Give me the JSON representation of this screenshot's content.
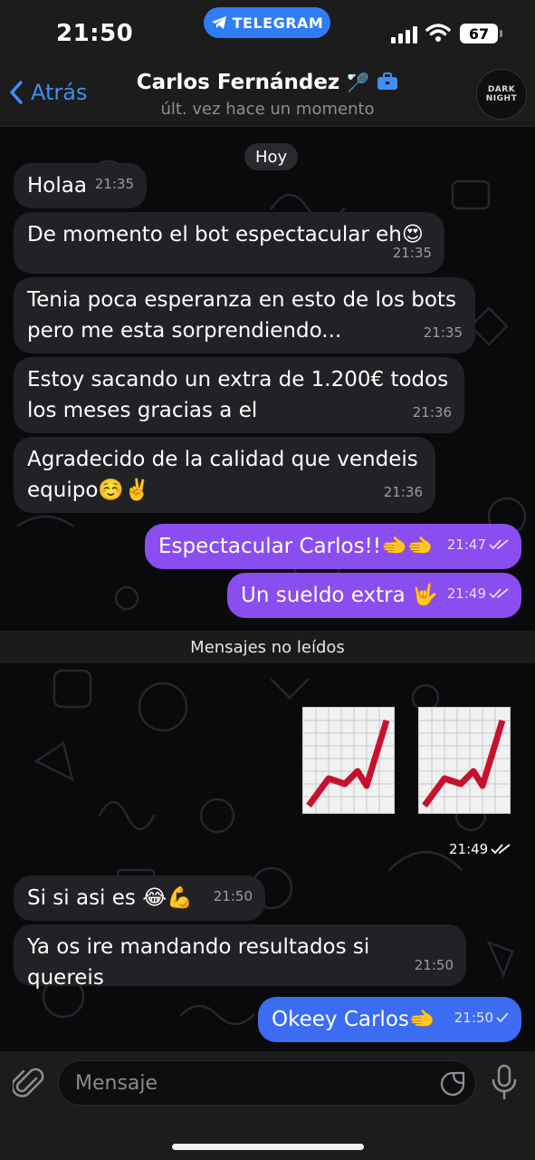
{
  "status_bar": {
    "time": "21:50",
    "pill_label": "TELEGRAM",
    "battery": "67"
  },
  "header": {
    "back_label": "Atrás",
    "name": "Carlos Fernández",
    "status": "últ. vez hace un momento",
    "avatar_text": [
      "DARK",
      "NIGHT"
    ]
  },
  "chat": {
    "date_chip": "Hoy",
    "unread_label": "Mensajes no leídos",
    "messages": [
      {
        "dir": "in",
        "text": "Holaa",
        "time": "21:35"
      },
      {
        "dir": "in",
        "text": "De momento el bot espectacular eh😍",
        "time": "21:35"
      },
      {
        "dir": "in",
        "text_lines": [
          "Tenia poca esperanza en esto de los bots",
          "pero me esta sorprendiendo..."
        ],
        "time": "21:35"
      },
      {
        "dir": "in",
        "text_lines": [
          "Estoy sacando un extra de 1.200€ todos",
          "los meses gracias a el"
        ],
        "time": "21:36"
      },
      {
        "dir": "in",
        "text_lines": [
          "Agradecido de la calidad que vendeis",
          "equipo☺️✌️"
        ],
        "time": "21:36"
      },
      {
        "dir": "out",
        "text": "Espectacular Carlos!!🫲🫲",
        "time": "21:47",
        "read": true
      },
      {
        "dir": "out",
        "text": "Un sueldo extra 🤟",
        "time": "21:49",
        "read": true
      },
      {
        "dir": "out",
        "type": "stickers",
        "sticker": "chart-increasing",
        "count": 2,
        "time": "21:49",
        "read": true
      },
      {
        "dir": "in",
        "text": "Si si asi es 😂💪",
        "time": "21:50"
      },
      {
        "dir": "in",
        "text": "Ya os ire mandando resultados si quereis",
        "time": "21:50"
      },
      {
        "dir": "out",
        "text": "Okeey Carlos🫲",
        "time": "21:50",
        "read": false
      }
    ]
  },
  "input": {
    "placeholder": "Mensaje"
  },
  "colors": {
    "accent": "#3e8ff3",
    "out_bubble": "#8a4df0",
    "out_bubble_last": "#3b6cf2",
    "in_bubble": "#222226"
  }
}
